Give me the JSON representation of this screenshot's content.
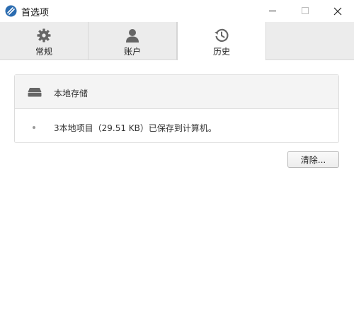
{
  "window": {
    "title": "首选项",
    "app_icon": "app-logo-icon",
    "controls": [
      "minimize-icon",
      "maximize-icon",
      "close-icon"
    ]
  },
  "tabs": [
    {
      "label": "常规",
      "icon": "gear-icon",
      "active": false
    },
    {
      "label": "账户",
      "icon": "user-icon",
      "active": false
    },
    {
      "label": "历史",
      "icon": "history-icon",
      "active": true
    }
  ],
  "storage": {
    "icon": "hard-drive-icon",
    "title": "本地存储",
    "summary": "3本地项目（29.51 KB）已保存到计算机。"
  },
  "actions": {
    "clear_label": "清除..."
  },
  "colors": {
    "tab_bar": "#ececec",
    "panel_header": "#f4f4f4",
    "icon_gray": "#666666",
    "app_icon_blue": "#2b6cb0"
  }
}
